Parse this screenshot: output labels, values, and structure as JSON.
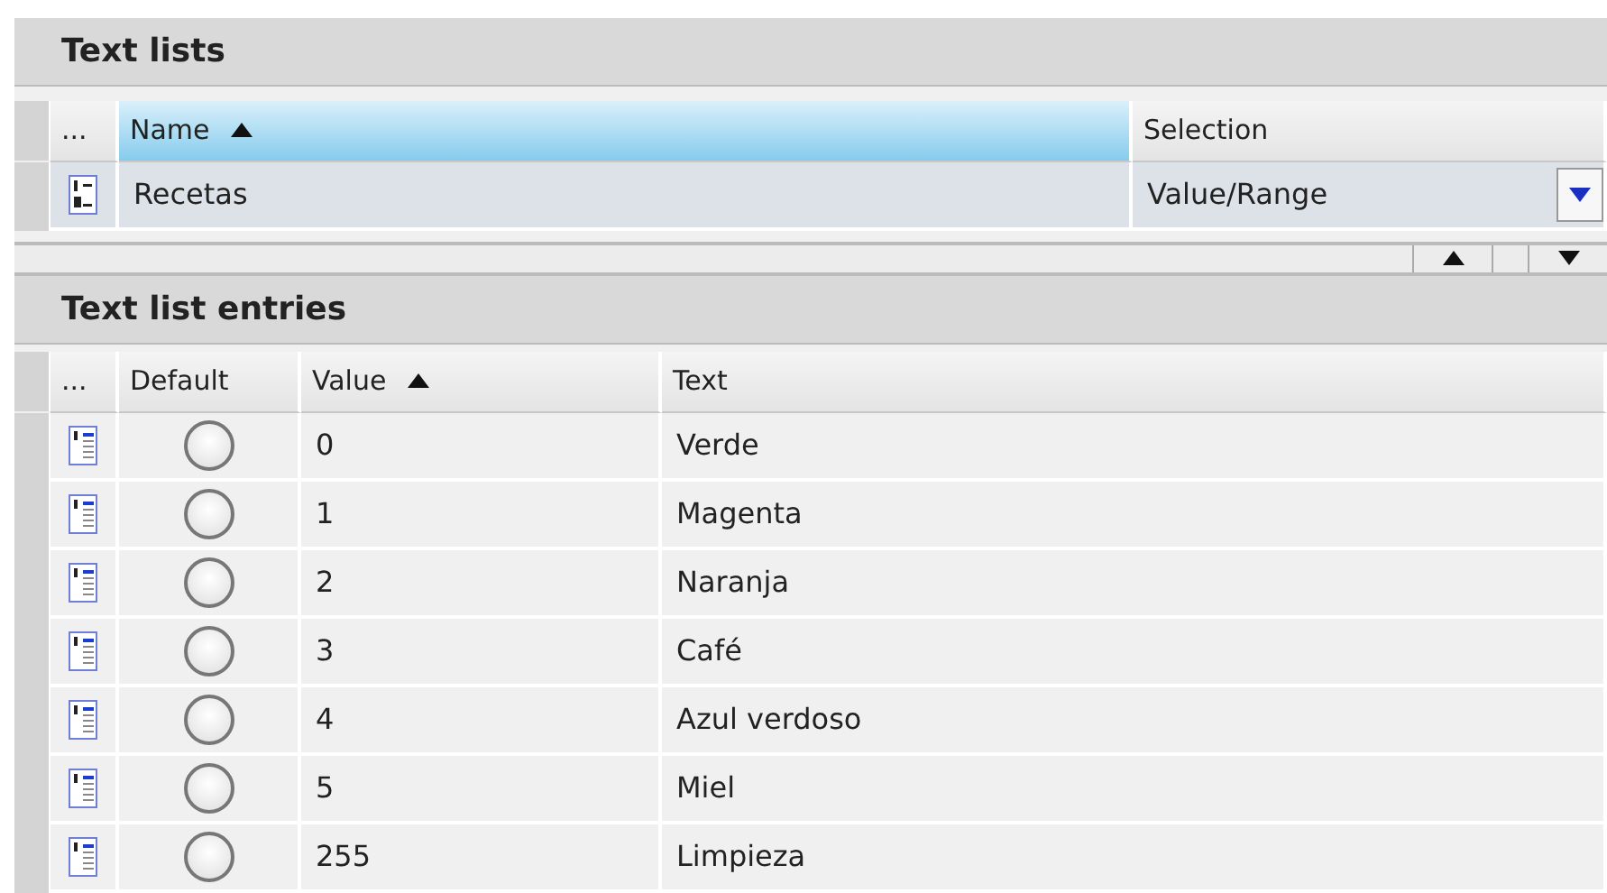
{
  "text_lists": {
    "title": "Text lists",
    "columns": [
      {
        "label": "...",
        "sorted": false,
        "highlighted": false
      },
      {
        "label": "Name",
        "sorted": true,
        "highlighted": true
      },
      {
        "label": "Selection",
        "sorted": false,
        "highlighted": false
      }
    ],
    "rows": [
      {
        "name": "Recetas",
        "selection": "Value/Range"
      }
    ]
  },
  "entries": {
    "title": "Text list entries",
    "columns": [
      {
        "label": "...",
        "sorted": false,
        "highlighted": false
      },
      {
        "label": "Default",
        "sorted": false,
        "highlighted": false
      },
      {
        "label": "Value",
        "sorted": true,
        "highlighted": false
      },
      {
        "label": "Text",
        "sorted": false,
        "highlighted": false
      }
    ],
    "rows": [
      {
        "default": false,
        "value": "0",
        "text": "Verde"
      },
      {
        "default": false,
        "value": "1",
        "text": "Magenta"
      },
      {
        "default": false,
        "value": "2",
        "text": "Naranja"
      },
      {
        "default": false,
        "value": "3",
        "text": "Café"
      },
      {
        "default": false,
        "value": "4",
        "text": "Azul verdoso"
      },
      {
        "default": false,
        "value": "5",
        "text": "Miel"
      },
      {
        "default": false,
        "value": "255",
        "text": "Limpieza"
      }
    ]
  }
}
